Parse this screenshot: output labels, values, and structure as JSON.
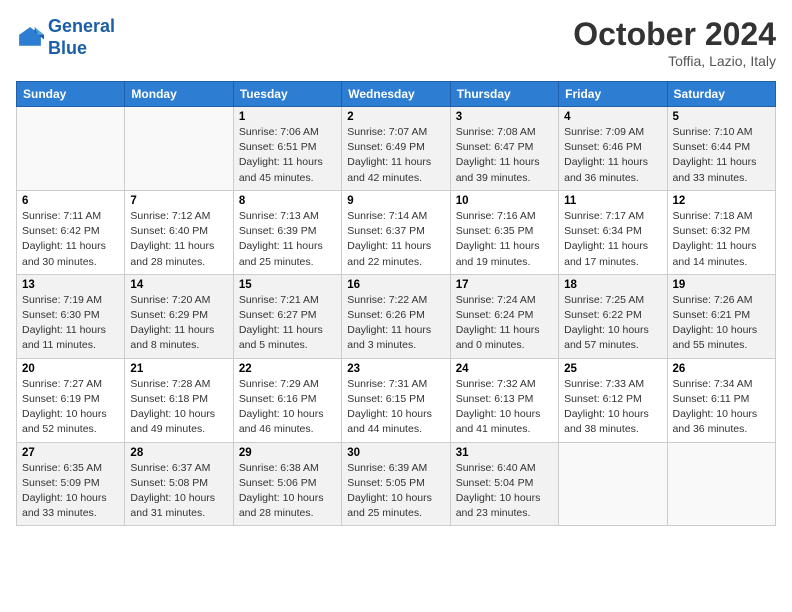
{
  "header": {
    "logo_line1": "General",
    "logo_line2": "Blue",
    "month": "October 2024",
    "location": "Toffia, Lazio, Italy"
  },
  "weekdays": [
    "Sunday",
    "Monday",
    "Tuesday",
    "Wednesday",
    "Thursday",
    "Friday",
    "Saturday"
  ],
  "weeks": [
    [
      {
        "day": "",
        "sunrise": "",
        "sunset": "",
        "daylight": ""
      },
      {
        "day": "",
        "sunrise": "",
        "sunset": "",
        "daylight": ""
      },
      {
        "day": "1",
        "sunrise": "Sunrise: 7:06 AM",
        "sunset": "Sunset: 6:51 PM",
        "daylight": "Daylight: 11 hours and 45 minutes."
      },
      {
        "day": "2",
        "sunrise": "Sunrise: 7:07 AM",
        "sunset": "Sunset: 6:49 PM",
        "daylight": "Daylight: 11 hours and 42 minutes."
      },
      {
        "day": "3",
        "sunrise": "Sunrise: 7:08 AM",
        "sunset": "Sunset: 6:47 PM",
        "daylight": "Daylight: 11 hours and 39 minutes."
      },
      {
        "day": "4",
        "sunrise": "Sunrise: 7:09 AM",
        "sunset": "Sunset: 6:46 PM",
        "daylight": "Daylight: 11 hours and 36 minutes."
      },
      {
        "day": "5",
        "sunrise": "Sunrise: 7:10 AM",
        "sunset": "Sunset: 6:44 PM",
        "daylight": "Daylight: 11 hours and 33 minutes."
      }
    ],
    [
      {
        "day": "6",
        "sunrise": "Sunrise: 7:11 AM",
        "sunset": "Sunset: 6:42 PM",
        "daylight": "Daylight: 11 hours and 30 minutes."
      },
      {
        "day": "7",
        "sunrise": "Sunrise: 7:12 AM",
        "sunset": "Sunset: 6:40 PM",
        "daylight": "Daylight: 11 hours and 28 minutes."
      },
      {
        "day": "8",
        "sunrise": "Sunrise: 7:13 AM",
        "sunset": "Sunset: 6:39 PM",
        "daylight": "Daylight: 11 hours and 25 minutes."
      },
      {
        "day": "9",
        "sunrise": "Sunrise: 7:14 AM",
        "sunset": "Sunset: 6:37 PM",
        "daylight": "Daylight: 11 hours and 22 minutes."
      },
      {
        "day": "10",
        "sunrise": "Sunrise: 7:16 AM",
        "sunset": "Sunset: 6:35 PM",
        "daylight": "Daylight: 11 hours and 19 minutes."
      },
      {
        "day": "11",
        "sunrise": "Sunrise: 7:17 AM",
        "sunset": "Sunset: 6:34 PM",
        "daylight": "Daylight: 11 hours and 17 minutes."
      },
      {
        "day": "12",
        "sunrise": "Sunrise: 7:18 AM",
        "sunset": "Sunset: 6:32 PM",
        "daylight": "Daylight: 11 hours and 14 minutes."
      }
    ],
    [
      {
        "day": "13",
        "sunrise": "Sunrise: 7:19 AM",
        "sunset": "Sunset: 6:30 PM",
        "daylight": "Daylight: 11 hours and 11 minutes."
      },
      {
        "day": "14",
        "sunrise": "Sunrise: 7:20 AM",
        "sunset": "Sunset: 6:29 PM",
        "daylight": "Daylight: 11 hours and 8 minutes."
      },
      {
        "day": "15",
        "sunrise": "Sunrise: 7:21 AM",
        "sunset": "Sunset: 6:27 PM",
        "daylight": "Daylight: 11 hours and 5 minutes."
      },
      {
        "day": "16",
        "sunrise": "Sunrise: 7:22 AM",
        "sunset": "Sunset: 6:26 PM",
        "daylight": "Daylight: 11 hours and 3 minutes."
      },
      {
        "day": "17",
        "sunrise": "Sunrise: 7:24 AM",
        "sunset": "Sunset: 6:24 PM",
        "daylight": "Daylight: 11 hours and 0 minutes."
      },
      {
        "day": "18",
        "sunrise": "Sunrise: 7:25 AM",
        "sunset": "Sunset: 6:22 PM",
        "daylight": "Daylight: 10 hours and 57 minutes."
      },
      {
        "day": "19",
        "sunrise": "Sunrise: 7:26 AM",
        "sunset": "Sunset: 6:21 PM",
        "daylight": "Daylight: 10 hours and 55 minutes."
      }
    ],
    [
      {
        "day": "20",
        "sunrise": "Sunrise: 7:27 AM",
        "sunset": "Sunset: 6:19 PM",
        "daylight": "Daylight: 10 hours and 52 minutes."
      },
      {
        "day": "21",
        "sunrise": "Sunrise: 7:28 AM",
        "sunset": "Sunset: 6:18 PM",
        "daylight": "Daylight: 10 hours and 49 minutes."
      },
      {
        "day": "22",
        "sunrise": "Sunrise: 7:29 AM",
        "sunset": "Sunset: 6:16 PM",
        "daylight": "Daylight: 10 hours and 46 minutes."
      },
      {
        "day": "23",
        "sunrise": "Sunrise: 7:31 AM",
        "sunset": "Sunset: 6:15 PM",
        "daylight": "Daylight: 10 hours and 44 minutes."
      },
      {
        "day": "24",
        "sunrise": "Sunrise: 7:32 AM",
        "sunset": "Sunset: 6:13 PM",
        "daylight": "Daylight: 10 hours and 41 minutes."
      },
      {
        "day": "25",
        "sunrise": "Sunrise: 7:33 AM",
        "sunset": "Sunset: 6:12 PM",
        "daylight": "Daylight: 10 hours and 38 minutes."
      },
      {
        "day": "26",
        "sunrise": "Sunrise: 7:34 AM",
        "sunset": "Sunset: 6:11 PM",
        "daylight": "Daylight: 10 hours and 36 minutes."
      }
    ],
    [
      {
        "day": "27",
        "sunrise": "Sunrise: 6:35 AM",
        "sunset": "Sunset: 5:09 PM",
        "daylight": "Daylight: 10 hours and 33 minutes."
      },
      {
        "day": "28",
        "sunrise": "Sunrise: 6:37 AM",
        "sunset": "Sunset: 5:08 PM",
        "daylight": "Daylight: 10 hours and 31 minutes."
      },
      {
        "day": "29",
        "sunrise": "Sunrise: 6:38 AM",
        "sunset": "Sunset: 5:06 PM",
        "daylight": "Daylight: 10 hours and 28 minutes."
      },
      {
        "day": "30",
        "sunrise": "Sunrise: 6:39 AM",
        "sunset": "Sunset: 5:05 PM",
        "daylight": "Daylight: 10 hours and 25 minutes."
      },
      {
        "day": "31",
        "sunrise": "Sunrise: 6:40 AM",
        "sunset": "Sunset: 5:04 PM",
        "daylight": "Daylight: 10 hours and 23 minutes."
      },
      {
        "day": "",
        "sunrise": "",
        "sunset": "",
        "daylight": ""
      },
      {
        "day": "",
        "sunrise": "",
        "sunset": "",
        "daylight": ""
      }
    ]
  ]
}
